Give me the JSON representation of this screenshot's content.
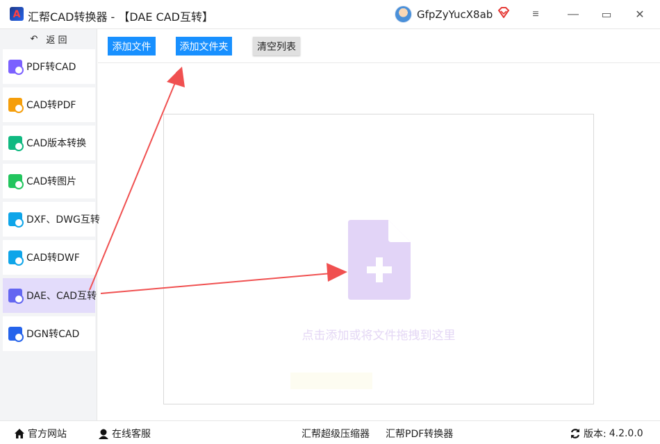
{
  "app": {
    "title": "汇帮CAD转换器 - 【DAE CAD互转】",
    "logo_letter": "A",
    "username": "GfpZyYucX8ab"
  },
  "window_controls": {
    "menu": "≡",
    "minimize": "—",
    "maximize": "▭",
    "close": "✕"
  },
  "sidebar": {
    "back_icon": "↶",
    "back_label": "返 回",
    "items": [
      {
        "label": "PDF转CAD",
        "icon": "pdf-to-cad-icon",
        "color": "#7b61ff"
      },
      {
        "label": "CAD转PDF",
        "icon": "cad-to-pdf-icon",
        "color": "#f59e0b"
      },
      {
        "label": "CAD版本转换",
        "icon": "cad-version-icon",
        "color": "#10b981"
      },
      {
        "label": "CAD转图片",
        "icon": "cad-to-image-icon",
        "color": "#22c55e"
      },
      {
        "label": "DXF、DWG互转",
        "icon": "dxf-dwg-icon",
        "color": "#0ea5e9"
      },
      {
        "label": "CAD转DWF",
        "icon": "cad-to-dwf-icon",
        "color": "#0ea5e9"
      },
      {
        "label": "DAE、CAD互转",
        "icon": "dae-cad-icon",
        "color": "#6366f1"
      },
      {
        "label": "DGN转CAD",
        "icon": "dgn-to-cad-icon",
        "color": "#2563eb"
      }
    ],
    "active_index": 6
  },
  "toolbar": {
    "add_file": "添加文件",
    "add_folder": "添加文件夹",
    "clear_list": "清空列表"
  },
  "dropzone": {
    "hint": "点击添加或将文件拖拽到这里",
    "icon_color": "#e2d4f7"
  },
  "footer": {
    "website": "官方网站",
    "online_service": "在线客服",
    "compressor": "汇帮超级压缩器",
    "pdf_converter": "汇帮PDF转换器",
    "version_label": "版本:",
    "version": "4.2.0.0"
  },
  "colors": {
    "accent_blue": "#1890ff",
    "active_nav": "#e3dcfb",
    "annotation_red": "#f05050"
  }
}
